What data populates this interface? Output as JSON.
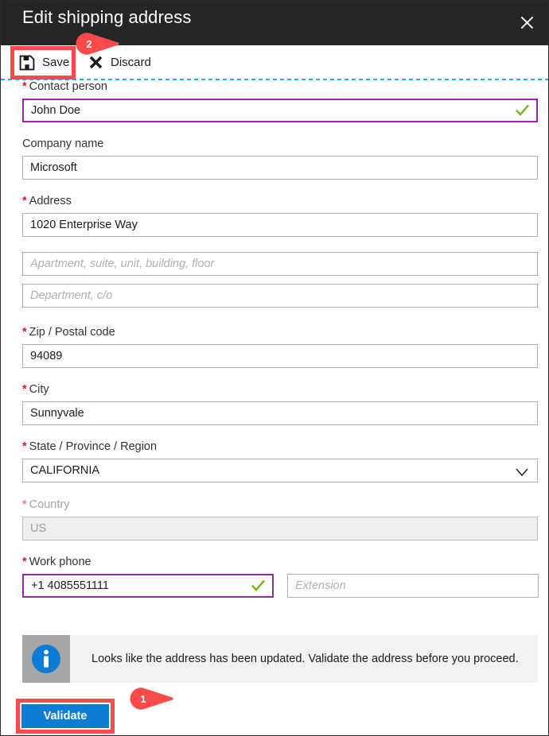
{
  "window": {
    "title": "Edit shipping address",
    "close_icon": "close-icon"
  },
  "commandbar": {
    "save_label": "Save",
    "save_icon": "save-floppy-icon",
    "discard_label": "Discard",
    "discard_icon": "close-x-icon"
  },
  "form": {
    "fields": [
      {
        "label": "Contact person",
        "required": true,
        "value": "John Doe",
        "placeholder": "",
        "state": "valid"
      },
      {
        "label": "Company name",
        "required": false,
        "value": "Microsoft",
        "placeholder": "",
        "state": "normal"
      },
      {
        "label": "Address",
        "required": true,
        "value": "1020 Enterprise Way",
        "placeholder": "",
        "state": "normal"
      },
      {
        "label": "",
        "required": false,
        "value": "",
        "placeholder": "Apartment, suite, unit, building, floor",
        "state": "normal"
      },
      {
        "label": "",
        "required": false,
        "value": "",
        "placeholder": "Department, c/o",
        "state": "normal"
      },
      {
        "label": "Zip / Postal code",
        "required": true,
        "value": "94089",
        "placeholder": "",
        "state": "normal"
      },
      {
        "label": "City",
        "required": true,
        "value": "Sunnyvale",
        "placeholder": "",
        "state": "normal"
      },
      {
        "label": "State / Province / Region",
        "required": true,
        "value": "CALIFORNIA",
        "placeholder": "",
        "state": "select"
      },
      {
        "label": "Country",
        "required": true,
        "value": "US",
        "placeholder": "",
        "state": "disabled"
      },
      {
        "label": "Work phone",
        "required": true,
        "value": "+1 4085551111",
        "placeholder": "",
        "state": "valid"
      },
      {
        "label": "",
        "required": false,
        "value": "",
        "placeholder": "Extension",
        "state": "normal"
      }
    ]
  },
  "infobar": {
    "icon": "info-circle-icon",
    "message": "Looks like the address has been updated. Validate the address before you proceed."
  },
  "actions": {
    "validate_label": "Validate"
  },
  "annotations": {
    "callouts": [
      {
        "number": "1",
        "target": "validate-button"
      },
      {
        "number": "2",
        "target": "save-button"
      }
    ]
  },
  "colors": {
    "titlebar_bg": "#262626",
    "accent_blue": "#0f7cd4",
    "required_red": "#e81123",
    "valid_border_purple": "#9429a6",
    "valid_check_green": "#7cb518",
    "annotation_red": "#fb4a4a",
    "info_bg": "#f2f2f2",
    "dashed_rule": "#16b5f0"
  }
}
